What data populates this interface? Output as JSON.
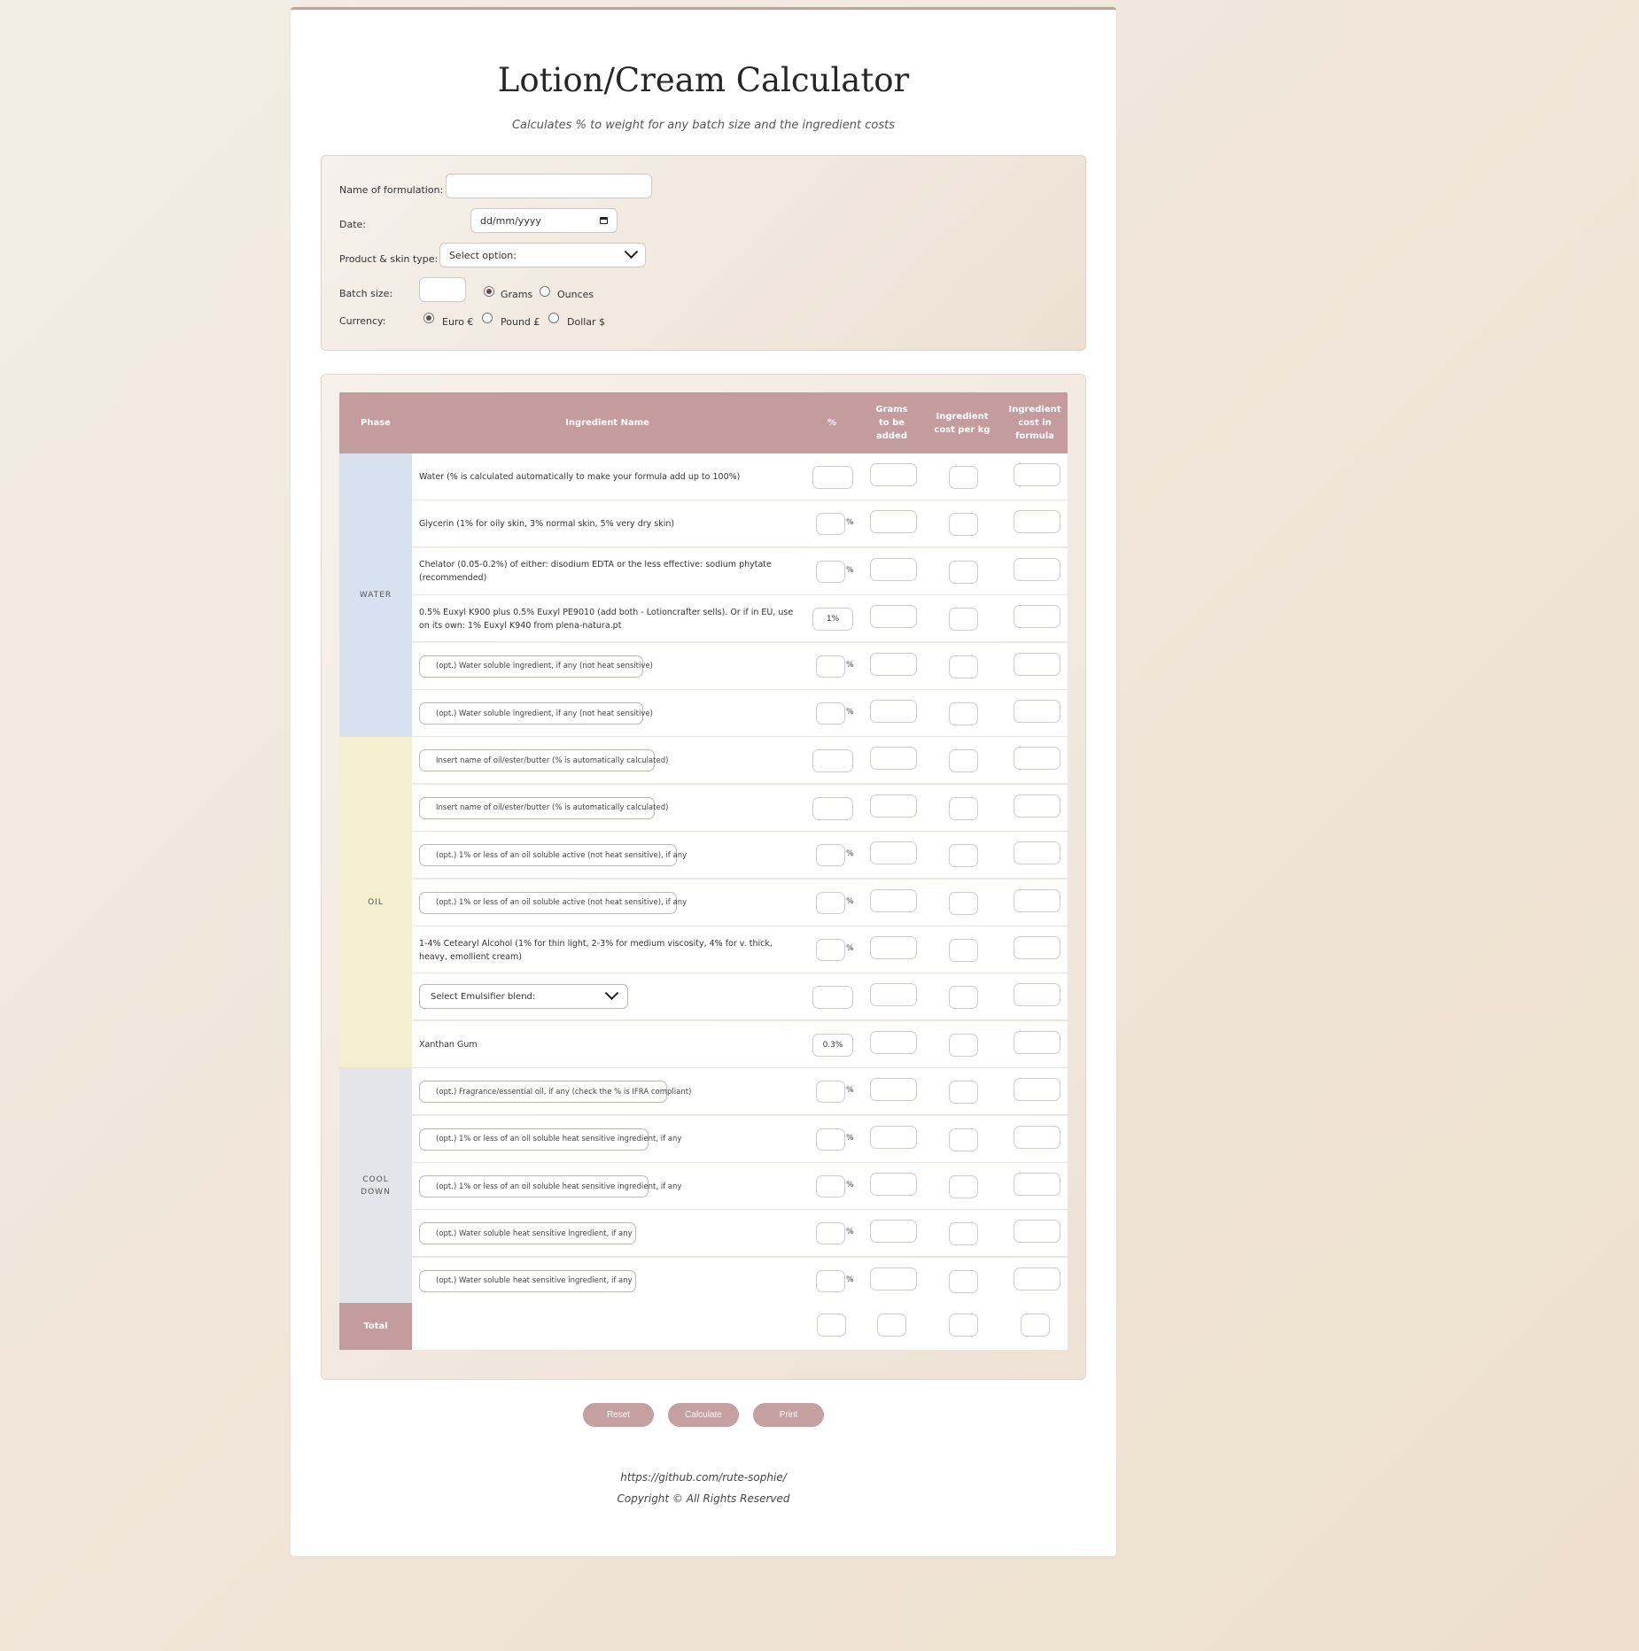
{
  "header": {
    "title": "Lotion/Cream Calculator",
    "subtitle": "Calculates % to weight for any batch size and the ingredient costs"
  },
  "form": {
    "name_label": "Name of formulation:",
    "name_value": "",
    "date_label": "Date:",
    "date_placeholder": "dd/mm/yyyy",
    "product_label": "Product & skin type:",
    "product_selected": "Select option:",
    "batch_label": "Batch size:",
    "batch_value": "",
    "units": [
      {
        "label": "Grams",
        "selected": true
      },
      {
        "label": "Ounces",
        "selected": false
      }
    ],
    "currency_label": "Currency:",
    "currencies": [
      {
        "label": "Euro €",
        "selected": true
      },
      {
        "label": "Pound £",
        "selected": false
      },
      {
        "label": "Dollar $",
        "selected": false
      }
    ]
  },
  "table": {
    "columns": [
      "Phase",
      "Ingredient Name",
      "%",
      "Grams to be added",
      "Ingredient cost per kg",
      "Ingredient cost in formula"
    ],
    "phases": [
      "WATER",
      "OIL",
      "COOL DOWN"
    ],
    "total_label": "Total",
    "percent_sign": "%",
    "rows": [
      {
        "phase": "WATER",
        "type": "text",
        "name": "Water (% is calculated automatically to make your formula add up to 100%)",
        "pct_mode": "calc",
        "pct_value": ""
      },
      {
        "phase": "WATER",
        "type": "text",
        "name": "Glycerin (1% for oily skin, 3% normal skin, 5% very dry skin)",
        "pct_mode": "input",
        "pct_value": ""
      },
      {
        "phase": "WATER",
        "type": "text",
        "name": "Chelator (0.05-0.2%) of either: disodium EDTA or the less effective: sodium phytate (recommended)",
        "pct_mode": "input",
        "pct_value": ""
      },
      {
        "phase": "WATER",
        "type": "text",
        "name": "0.5% Euxyl K900 plus 0.5% Euxyl PE9010 (add both - Lotioncrafter sells). Or if in EU, use on its own: 1% Euxyl K940 from plena-natura.pt",
        "pct_mode": "fixed",
        "pct_value": "1%"
      },
      {
        "phase": "WATER",
        "type": "input",
        "name": "(opt.) Water soluble ingredient, if any (not heat sensitive)",
        "pct_mode": "input",
        "pct_value": ""
      },
      {
        "phase": "WATER",
        "type": "input",
        "name": "(opt.) Water soluble ingredient, if any (not heat sensitive)",
        "pct_mode": "input",
        "pct_value": ""
      },
      {
        "phase": "OIL",
        "type": "input",
        "name": "Insert name of oil/ester/butter (% is automatically calculated)",
        "pct_mode": "calc",
        "pct_value": ""
      },
      {
        "phase": "OIL",
        "type": "input",
        "name": "Insert name of oil/ester/butter (% is automatically calculated)",
        "pct_mode": "calc",
        "pct_value": ""
      },
      {
        "phase": "OIL",
        "type": "input",
        "name": "(opt.) 1% or less of an oil soluble active (not heat sensitive), if any",
        "pct_mode": "input",
        "pct_value": ""
      },
      {
        "phase": "OIL",
        "type": "input",
        "name": "(opt.) 1% or less of an oil soluble active (not heat sensitive), if any",
        "pct_mode": "input",
        "pct_value": ""
      },
      {
        "phase": "OIL",
        "type": "text",
        "name": "1-4% Cetearyl Alcohol (1% for thin light, 2-3% for medium viscosity, 4% for v. thick, heavy, emollient cream)",
        "pct_mode": "input",
        "pct_value": ""
      },
      {
        "phase": "OIL",
        "type": "select",
        "name": "Select Emulsifier blend:",
        "pct_mode": "calc",
        "pct_value": ""
      },
      {
        "phase": "OIL",
        "type": "text",
        "name": "Xanthan Gum",
        "pct_mode": "fixed",
        "pct_value": "0.3%"
      },
      {
        "phase": "COOL DOWN",
        "type": "input",
        "name": "(opt.) Fragrance/essential oil, if any (check the % is IFRA compliant)",
        "pct_mode": "input",
        "pct_value": ""
      },
      {
        "phase": "COOL DOWN",
        "type": "input",
        "name": "(opt.) 1% or less of an oil soluble heat sensitive ingredient, if any",
        "pct_mode": "input",
        "pct_value": ""
      },
      {
        "phase": "COOL DOWN",
        "type": "input",
        "name": "(opt.) 1% or less of an oil soluble heat sensitive ingredient, if any",
        "pct_mode": "input",
        "pct_value": ""
      },
      {
        "phase": "COOL DOWN",
        "type": "input",
        "name": "(opt.) Water soluble heat sensitive ingredient, if any",
        "pct_mode": "input",
        "pct_value": ""
      },
      {
        "phase": "COOL DOWN",
        "type": "input",
        "name": "(opt.) Water soluble heat sensitive ingredient, if any",
        "pct_mode": "input",
        "pct_value": ""
      }
    ]
  },
  "buttons": {
    "reset": "Reset",
    "calculate": "Calculate",
    "print": "Print"
  },
  "footer": {
    "link": "https://github.com/rute-sophie/",
    "copyright": "Copyright © All Rights Reserved"
  },
  "colors": {
    "header_bg": "#c49c9e",
    "water_phase": "#d7e1f0",
    "oil_phase": "#f3efcf",
    "cooldown_phase": "#e3e5ea",
    "button": "#c4a0a1"
  }
}
